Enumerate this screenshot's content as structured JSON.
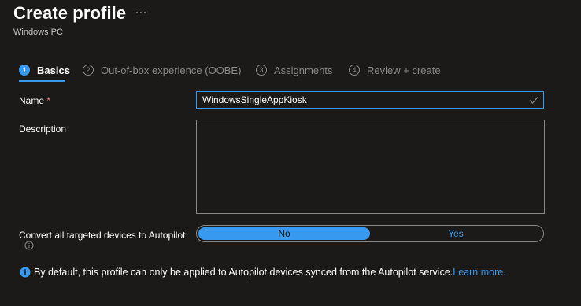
{
  "header": {
    "title": "Create profile",
    "more_label": "···",
    "subtitle": "Windows PC"
  },
  "steps": [
    {
      "number": "1",
      "label": "Basics",
      "active": true
    },
    {
      "number": "2",
      "label": "Out-of-box experience (OOBE)",
      "active": false
    },
    {
      "number": "3",
      "label": "Assignments",
      "active": false
    },
    {
      "number": "4",
      "label": "Review + create",
      "active": false
    }
  ],
  "form": {
    "name_label": "Name",
    "required_marker": "*",
    "name_value": "WindowsSingleAppKiosk",
    "description_label": "Description",
    "description_value": "",
    "convert_label": "Convert all targeted devices to Autopilot",
    "toggle_options": [
      "No",
      "Yes"
    ],
    "toggle_selected": "No"
  },
  "info": {
    "text": "By default, this profile can only be applied to Autopilot devices synced from the Autopilot service.",
    "link_text": "Learn more."
  },
  "colors": {
    "background": "#1b1a19",
    "accent": "#3899f0",
    "muted": "#8a8886",
    "required": "#f1707b"
  },
  "icons": {
    "more": "more-horizontal-icon",
    "valid": "checkmark-icon",
    "info": "info-icon"
  }
}
